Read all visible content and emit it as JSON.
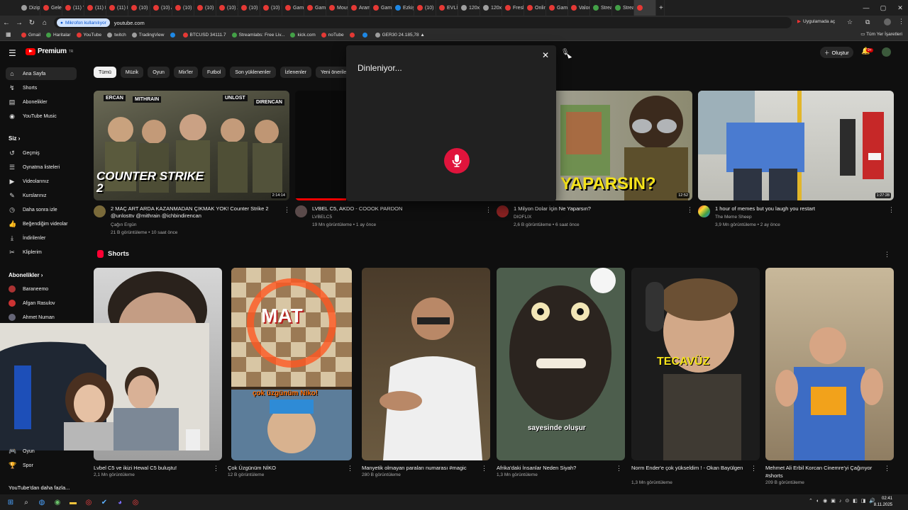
{
  "browser": {
    "tabs": [
      {
        "label": "Dizip",
        "color": "gray"
      },
      {
        "label": "Geler",
        "color": "red"
      },
      {
        "label": "(11) Y",
        "color": "red"
      },
      {
        "label": "(11) K",
        "color": "red"
      },
      {
        "label": "(11) N",
        "color": "red"
      },
      {
        "label": "(10) E",
        "color": "red"
      },
      {
        "label": "(10) A",
        "color": "red"
      },
      {
        "label": "(10) D",
        "color": "red"
      },
      {
        "label": "(10) E",
        "color": "red"
      },
      {
        "label": "(10) Z",
        "color": "red"
      },
      {
        "label": "(10) B",
        "color": "red"
      },
      {
        "label": "(10) E",
        "color": "red"
      },
      {
        "label": "Gamo",
        "color": "red"
      },
      {
        "label": "Gamo",
        "color": "red"
      },
      {
        "label": "Mous",
        "color": "red"
      },
      {
        "label": "Aram",
        "color": "red"
      },
      {
        "label": "Gamo",
        "color": "red"
      },
      {
        "label": "Ezkiş",
        "color": "blue"
      },
      {
        "label": "(10) E",
        "color": "red"
      },
      {
        "label": "EVLİL",
        "color": "red"
      },
      {
        "label": "120x6",
        "color": "gray"
      },
      {
        "label": "120x6",
        "color": "gray"
      },
      {
        "label": "Fresh",
        "color": "red"
      },
      {
        "label": "Onlin",
        "color": "red"
      },
      {
        "label": "Gamo",
        "color": "red"
      },
      {
        "label": "Valor",
        "color": "red"
      },
      {
        "label": "Strea",
        "color": "green"
      },
      {
        "label": "Strea",
        "color": "green"
      },
      {
        "label": "",
        "color": "red",
        "active": true
      }
    ],
    "mic_chip": "Mikrofon kullanılıyor",
    "url": "youtube.com",
    "app_chip": "Uygulamada aç",
    "bookmarks": [
      {
        "label": "Gmail",
        "color": "red"
      },
      {
        "label": "Haritalar",
        "color": "green"
      },
      {
        "label": "YouTube",
        "color": "red"
      },
      {
        "label": "twitch",
        "color": "gray"
      },
      {
        "label": "TradingView",
        "color": "gray"
      },
      {
        "label": "",
        "color": "blue"
      },
      {
        "label": "BTCUSD 34111.7",
        "color": "red"
      },
      {
        "label": "Streamlabs: Free Liv...",
        "color": "green"
      },
      {
        "label": "kick.com",
        "color": "green"
      },
      {
        "label": "noTube",
        "color": "red"
      },
      {
        "label": "",
        "color": "red"
      },
      {
        "label": "",
        "color": "blue"
      },
      {
        "label": "GER30 24.185,78 ▲",
        "color": "gray"
      }
    ],
    "all_bookmarks": "Tüm Yer İşaretleri"
  },
  "header": {
    "logo": "Premium",
    "logo_sup": "TR",
    "create": "Oluştur",
    "notif_count": "9+"
  },
  "sidebar": {
    "main": [
      {
        "label": "Ana Sayfa",
        "icon": "home-icon",
        "glyph": "⌂"
      },
      {
        "label": "Shorts",
        "icon": "shorts-icon",
        "glyph": "↯"
      },
      {
        "label": "Abonelikler",
        "icon": "subscriptions-icon",
        "glyph": "▤"
      },
      {
        "label": "YouTube Music",
        "icon": "music-icon",
        "glyph": "◉"
      }
    ],
    "you_header": "Siz",
    "you": [
      {
        "label": "Geçmiş",
        "icon": "history-icon",
        "glyph": "↺"
      },
      {
        "label": "Oynatma listeleri",
        "icon": "playlists-icon",
        "glyph": "☰"
      },
      {
        "label": "Videolarınız",
        "icon": "your-videos-icon",
        "glyph": "▶"
      },
      {
        "label": "Kurslarınız",
        "icon": "courses-icon",
        "glyph": "✎"
      },
      {
        "label": "Daha sonra izle",
        "icon": "watch-later-icon",
        "glyph": "◷"
      },
      {
        "label": "Beğendiğim videolar",
        "icon": "liked-icon",
        "glyph": "👍"
      },
      {
        "label": "İndirilenler",
        "icon": "downloads-icon",
        "glyph": "⤓"
      },
      {
        "label": "Kliplerim",
        "icon": "clips-icon",
        "glyph": "✂"
      }
    ],
    "subs_header": "Abonelikler",
    "subs": [
      {
        "label": "Baraneemo",
        "color": "#a33"
      },
      {
        "label": "Afgan Rasulov",
        "color": "#c33"
      },
      {
        "label": "Ahmet Numan",
        "color": "#667"
      }
    ],
    "explore": [
      {
        "label": "Oyun",
        "icon": "gaming-icon",
        "glyph": "🎮"
      },
      {
        "label": "Spor",
        "icon": "sports-icon",
        "glyph": "🏆"
      }
    ],
    "more": "YouTube'dan daha fazla..."
  },
  "chips": [
    "Tümü",
    "Müzik",
    "Oyun",
    "Mix'ler",
    "Futbol",
    "Son yüklenenler",
    "İzlenenler",
    "Yeni öneriler"
  ],
  "videos": [
    {
      "title": "2 MAÇ ART ARDA KAZANMADAN ÇIKMAK YOK! Counter Strike 2 @unlosttv @mithrain @ichbindirencan",
      "channel": "Çağın Ergün",
      "meta": "21 B görüntüleme • 10 saat önce",
      "duration": "2:14:14",
      "overlay": "COUNTER STRIKE 2",
      "names": [
        "ERCAN",
        "MITHRAIN",
        "UNLOST",
        "DIRENCAN"
      ]
    },
    {
      "title": "LVBEL C5, AKDO - COOOK PARDON",
      "channel": "LVBELC5",
      "meta": "19 Mn görüntüleme • 1 ay önce",
      "duration": ""
    },
    {
      "title": "1 Milyon Dolar İçin Ne Yaparsın?",
      "channel": "DIOFLIX",
      "meta": "2,6 B görüntüleme • 6 saat önce",
      "duration": "12:52",
      "overlay": "YAPARSIN?"
    },
    {
      "title": "1 hour of memes but you laugh you restart",
      "channel": "The Meme Sheep",
      "meta": "3,9 Mn görüntüleme • 2 ay önce",
      "duration": "1:27:28"
    }
  ],
  "shorts_title": "Shorts",
  "shorts": [
    {
      "title": "Lvbel C5 ve ikizi Hewal C5 buluştu!",
      "meta": "2,1 Mn görüntüleme"
    },
    {
      "title": "Çok Üzgünüm NİKO",
      "meta": "12 B görüntüleme",
      "overlay1": "MAT",
      "overlay2": "çok üzgünüm Niko!"
    },
    {
      "title": "Manyetik olmayan paraları numarası #magic",
      "meta": "280 B görüntüleme"
    },
    {
      "title": "Afrika'daki İnsanlar Neden Siyah?",
      "meta": "1,3 Mn görüntüleme",
      "overlay1": "sayesinde oluşur"
    },
    {
      "title": "Norm Ender'e çok yükseldim ! - Okan Bayülgen",
      "meta": "1,3 Mn görüntüleme",
      "overlay1": "TECAVÜZ"
    },
    {
      "title": "Mehmet Ali Erbil Korcan Cinemre'yi Çağırıyor #shorts",
      "meta": "209 B görüntüleme"
    }
  ],
  "voice": {
    "listening": "Dinleniyor..."
  },
  "taskbar": {
    "time": "02:41",
    "date": "8.11.2025"
  }
}
